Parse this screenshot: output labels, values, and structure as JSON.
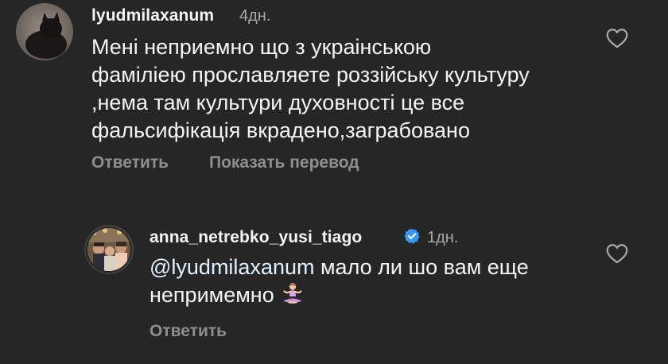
{
  "comments": [
    {
      "username": "lyudmilaxanum",
      "time": "4дн.",
      "lines": [
        "Мені неприемно що з украiнськoю",
        "фамiлiею прославляете роззiйську культуру",
        ",нема там культури духовностi це все",
        "фальсифiкацiя вкрадено,заграбовано"
      ],
      "reply_label": "Ответить",
      "translate_label": "Показать перевод"
    },
    {
      "username": "anna_netrebko_yusi_tiago",
      "verified": true,
      "time": "1дн.",
      "mention": "@lyudmilaxanum",
      "line1_rest": " мало ли шо вам еще",
      "line2": "непримемно",
      "emoji": "person-in-lotus-position",
      "reply_label": "Ответить"
    }
  ],
  "icons": {
    "like": "heart-outline-icon",
    "verified": "verified-badge-icon"
  },
  "colors": {
    "background": "#262626",
    "text": "#f5f5f5",
    "secondary": "#a8a8a8",
    "action": "#8e8e8e",
    "verified": "#3897f0",
    "mention": "#e0f1ff"
  }
}
